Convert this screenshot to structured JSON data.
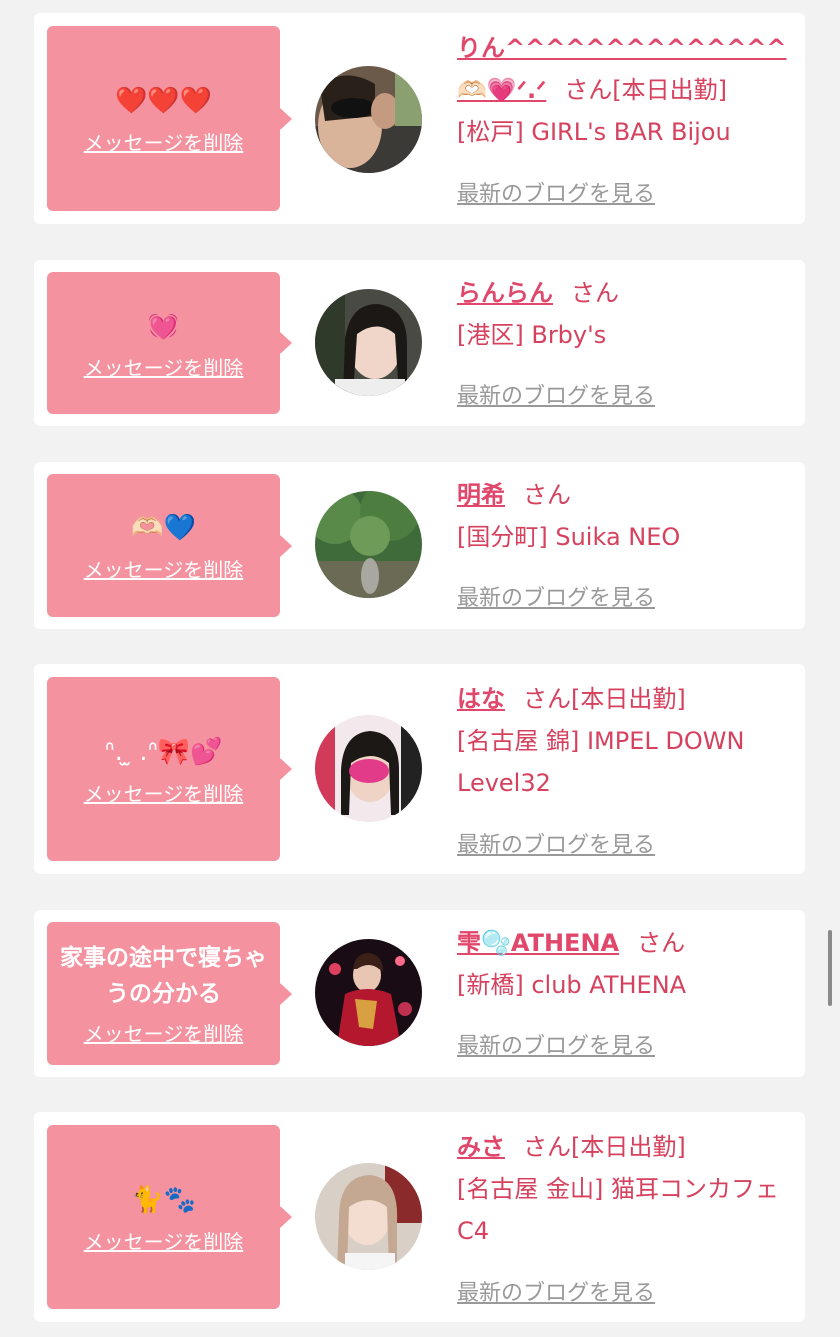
{
  "delete_label": "メッセージを削除",
  "blog_label": "最新のブログを見る",
  "san_label": "さん",
  "colors": {
    "accent": "#f4929f",
    "name": "#e0476b",
    "text": "#d6415e",
    "muted": "#999999"
  },
  "items": [
    {
      "message": "❤️❤️❤️",
      "name": "りん^^^^^^^^^^^^^^🫶🏻💗ᐟ.ᐟ",
      "tag": "[本日出勤]",
      "shop": "[松戸] GIRL's BAR Bijou"
    },
    {
      "message": "💓",
      "name": "らんらん",
      "tag": "",
      "shop": "[港区] Brby's"
    },
    {
      "message": "🫶🏻💙",
      "name": "明希",
      "tag": "",
      "shop": "[国分町] Suika NEO"
    },
    {
      "message": "ᐢ. ̫ .ᐢ🎀💕",
      "name": "はな",
      "tag": "[本日出勤]",
      "shop": "[名古屋 錦] IMPEL DOWN Level32"
    },
    {
      "message": "家事の途中で寝ちゃうの分かる",
      "name": "雫🫧ATHENA",
      "tag": "",
      "shop": "[新橋] club ATHENA"
    },
    {
      "message": "🐈🐾",
      "name": "みさ",
      "tag": "[本日出勤]",
      "shop": "[名古屋 金山] 猫耳コンカフェ C4"
    }
  ]
}
